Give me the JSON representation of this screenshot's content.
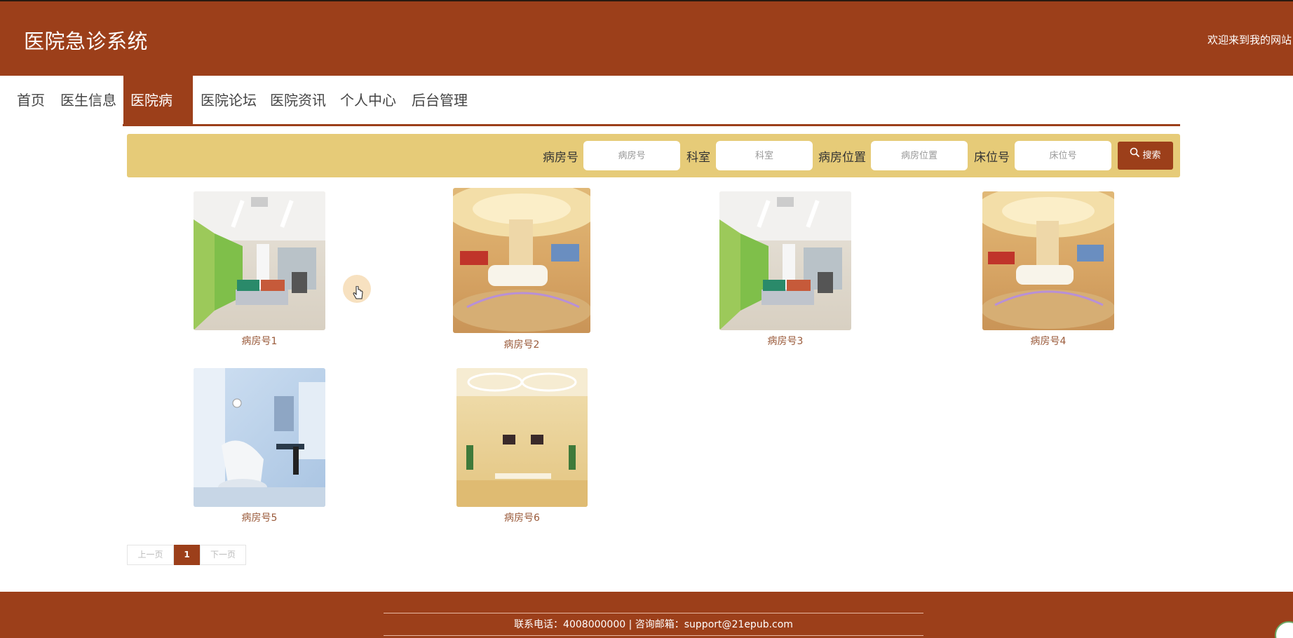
{
  "header": {
    "site_title": "医院急诊系统",
    "welcome": "欢迎来到我的网站"
  },
  "nav": {
    "items": [
      {
        "label": "首页"
      },
      {
        "label": "医生信息"
      },
      {
        "label": "医院病房",
        "active": true
      },
      {
        "label": "医院论坛"
      },
      {
        "label": "医院资讯"
      },
      {
        "label": "个人中心"
      },
      {
        "label": "后台管理"
      }
    ]
  },
  "search": {
    "fields": [
      {
        "label": "病房号",
        "placeholder": "病房号",
        "value": ""
      },
      {
        "label": "科室",
        "placeholder": "科室",
        "value": ""
      },
      {
        "label": "病房位置",
        "placeholder": "病房位置",
        "value": ""
      },
      {
        "label": "床位号",
        "placeholder": "床位号",
        "value": ""
      }
    ],
    "button_label": "搜索",
    "button_icon": "search-icon"
  },
  "rooms": [
    {
      "caption": "病房号1",
      "scene": "corridor-lounge"
    },
    {
      "caption": "病房号2",
      "scene": "lobby-reception"
    },
    {
      "caption": "病房号3",
      "scene": "corridor-lounge"
    },
    {
      "caption": "病房号4",
      "scene": "lobby-reception"
    },
    {
      "caption": "病房号5",
      "scene": "dental-room"
    },
    {
      "caption": "病房号6",
      "scene": "waiting-hall"
    }
  ],
  "pagination": {
    "prev_label": "上一页",
    "current_page": "1",
    "next_label": "下一页"
  },
  "footer": {
    "contact": "联系电话：4008000000 | 咨询邮箱：support@21epub.com"
  },
  "colors": {
    "brand": "#9c3f1a",
    "search_bar": "#e6cb78",
    "caption": "#9a5a3a"
  }
}
